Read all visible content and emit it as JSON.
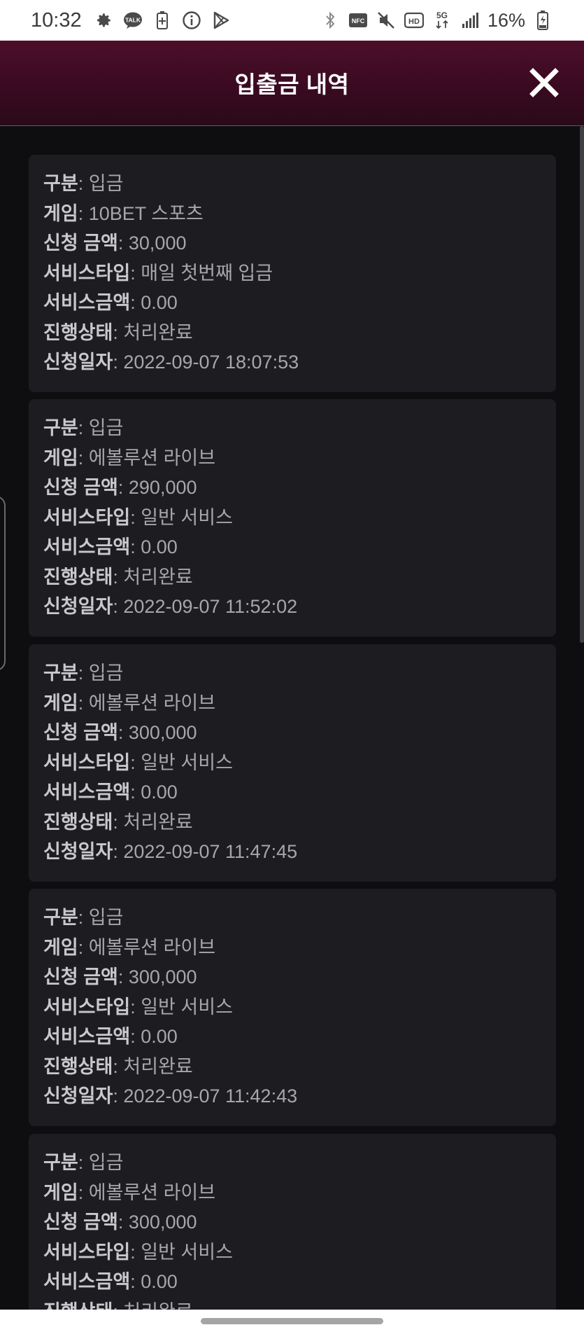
{
  "status_bar": {
    "time": "10:32",
    "left_icons": [
      "gear-icon",
      "kakaotalk-icon",
      "battery-saver-icon",
      "info-icon",
      "play-store-icon"
    ],
    "talk_label": "TALK",
    "right_icons": [
      "bluetooth-icon",
      "nfc-icon",
      "mute-icon",
      "hd-icon",
      "5g-icon",
      "signal-icon",
      "battery-icon"
    ],
    "nfc_label": "NFC",
    "hd_label": "HD",
    "net_label": "5G",
    "battery_percent": "16%"
  },
  "header": {
    "title": "입출금 내역",
    "close_icon": "close-icon"
  },
  "labels": {
    "type": "구분",
    "game": "게임",
    "amount": "신청 금액",
    "service_type": "서비스타입",
    "service_amount": "서비스금액",
    "status": "진행상태",
    "date": "신청일자",
    "sep": ": "
  },
  "records": [
    {
      "type": "입금",
      "game": "10BET 스포츠",
      "amount": "30,000",
      "service_type": "매일 첫번째 입금",
      "service_amount": "0.00",
      "status": "처리완료",
      "date": "2022-09-07 18:07:53"
    },
    {
      "type": "입금",
      "game": "에볼루션 라이브",
      "amount": "290,000",
      "service_type": "일반 서비스",
      "service_amount": "0.00",
      "status": "처리완료",
      "date": "2022-09-07 11:52:02"
    },
    {
      "type": "입금",
      "game": "에볼루션 라이브",
      "amount": "300,000",
      "service_type": "일반 서비스",
      "service_amount": "0.00",
      "status": "처리완료",
      "date": "2022-09-07 11:47:45"
    },
    {
      "type": "입금",
      "game": "에볼루션 라이브",
      "amount": "300,000",
      "service_type": "일반 서비스",
      "service_amount": "0.00",
      "status": "처리완료",
      "date": "2022-09-07 11:42:43"
    },
    {
      "type": "입금",
      "game": "에볼루션 라이브",
      "amount": "300,000",
      "service_type": "일반 서비스",
      "service_amount": "0.00",
      "status": "처리완료",
      "date": ""
    }
  ],
  "colors": {
    "header_bg": "#3a0a21",
    "page_bg": "#0e0e10",
    "card_bg": "#1d1d21",
    "label_text": "#c9c9cc",
    "value_text": "#a7a7ab"
  }
}
